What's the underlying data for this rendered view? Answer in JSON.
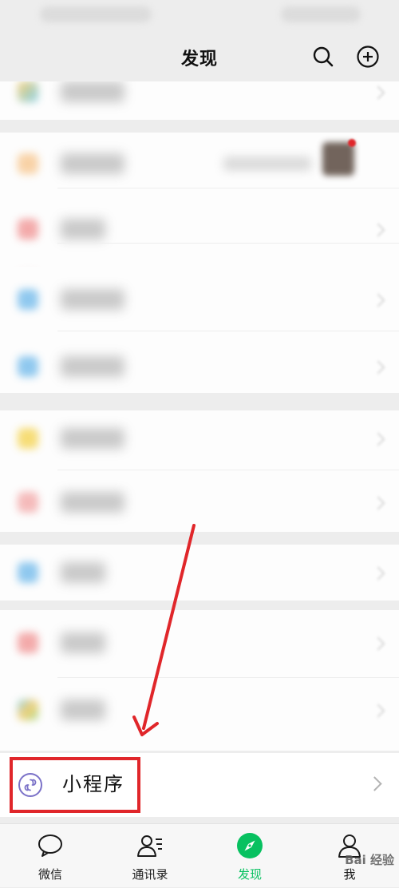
{
  "header": {
    "title": "发现",
    "search_icon": "search-icon",
    "add_icon": "plus-circle-icon"
  },
  "mini_program": {
    "label": "小程序",
    "icon": "link-icon"
  },
  "tabs": [
    {
      "label": "微信",
      "icon": "chat-bubble-icon",
      "active": false
    },
    {
      "label": "通讯录",
      "icon": "contacts-icon",
      "active": false
    },
    {
      "label": "发现",
      "icon": "compass-icon",
      "active": true
    },
    {
      "label": "我",
      "icon": "person-icon",
      "active": false
    }
  ],
  "watermark": "Bai 经验",
  "colors": {
    "accent": "#07c160",
    "highlight": "#e0262a",
    "background": "#ededed"
  }
}
